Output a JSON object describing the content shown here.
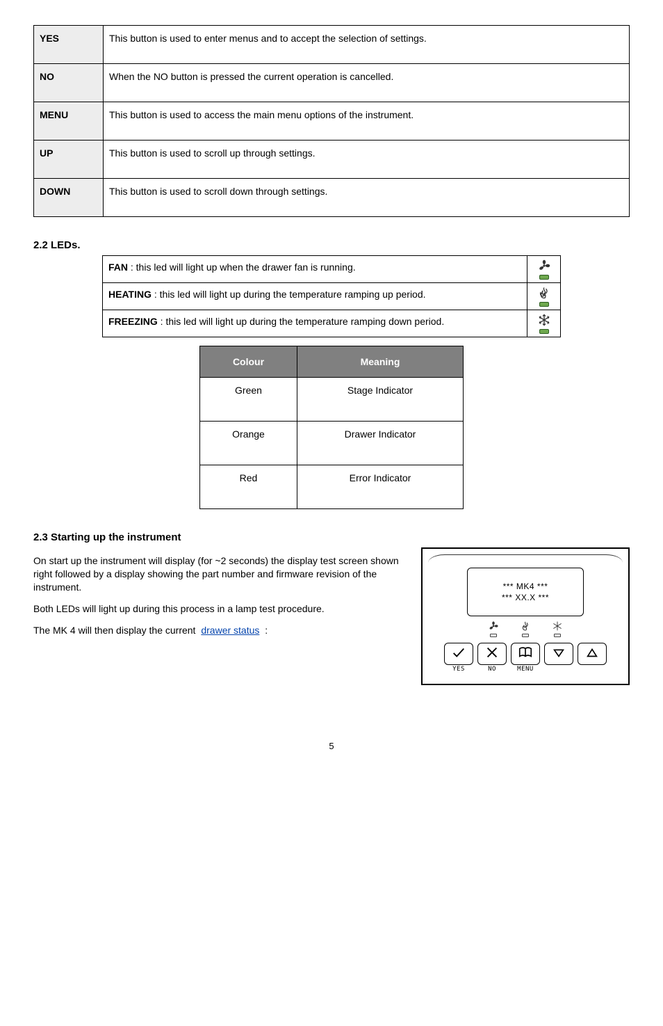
{
  "buttons_table": {
    "rows": [
      {
        "label": "YES",
        "desc": "This button is used to enter menus and to accept the selection of settings."
      },
      {
        "label": "NO",
        "desc": "When the NO button is pressed the current operation is cancelled."
      },
      {
        "label": "MENU",
        "desc": "This button is used to access the main menu options of the instrument."
      },
      {
        "label": "UP",
        "desc": "This button is used to scroll up through settings."
      },
      {
        "label": "DOWN",
        "desc": "This button is used to scroll down through settings."
      }
    ]
  },
  "leds": {
    "title": "2.2 LEDs.",
    "rows": [
      {
        "text_1": "FAN",
        "text_2": " : this led will light up when the drawer fan is running.",
        "icon": "fan"
      },
      {
        "text_1": "HEATING",
        "text_2": " : this led will light up during the temperature ramping up period.",
        "icon": "flame"
      },
      {
        "text_1": "FREEZING",
        "text_2": " : this led will light up during the temperature ramping down period.",
        "icon": "snow"
      }
    ]
  },
  "colors_table": {
    "headers": [
      "Colour",
      "Meaning"
    ],
    "rows": [
      {
        "c": "Green",
        "m": "Stage Indicator"
      },
      {
        "c": "Orange",
        "m": "Drawer Indicator"
      },
      {
        "c": "Red",
        "m": "Error Indicator"
      }
    ]
  },
  "start": {
    "title": "2.3 Starting up the instrument",
    "p1": "On start up the instrument will display (for ~2 seconds) the display test screen shown right followed by a display showing the part number and firmware revision of the instrument.",
    "p2": "Both LEDs will light up during this process in a lamp test procedure.",
    "p3_pre": "The MK 4 will then display the current",
    "p3_link": "drawer status",
    "p3_post": " :"
  },
  "panel": {
    "lcd_line1": "*** MK4  ***",
    "lcd_line2": "*** XX.X ***",
    "btn_labels": {
      "yes": "YES",
      "no": "NO",
      "menu": "MENU"
    }
  },
  "page_number": "5"
}
